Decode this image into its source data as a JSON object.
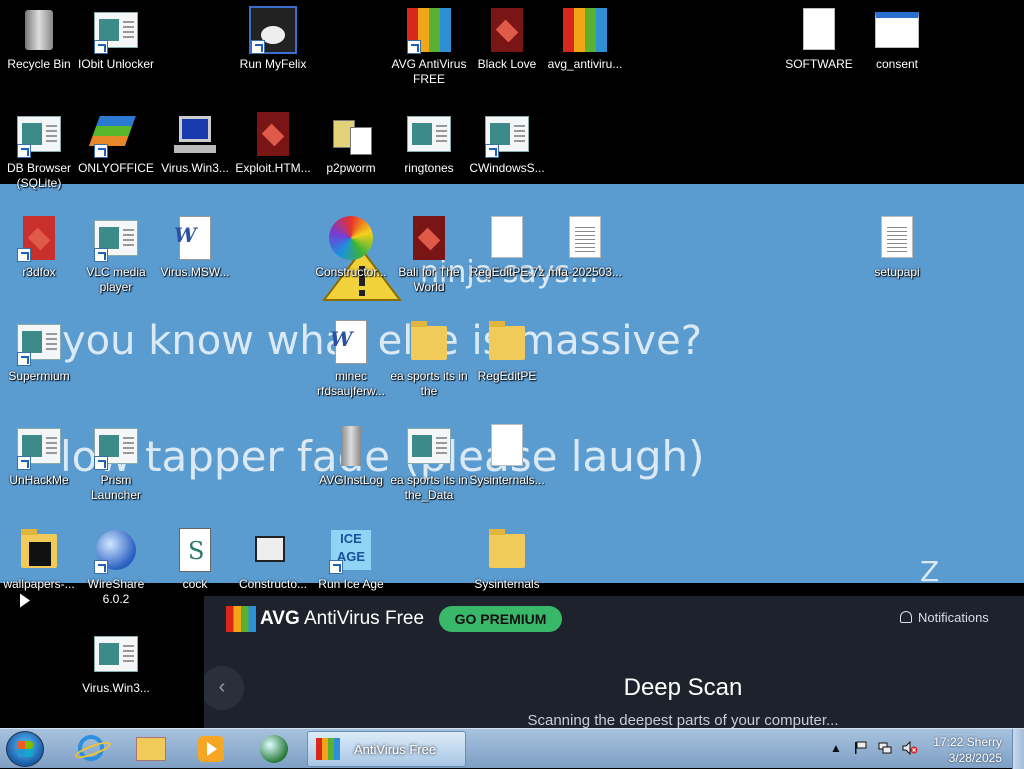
{
  "desktop": {
    "icons": [
      {
        "label": "Recycle Bin",
        "icon": "recycle-bin-icon"
      },
      {
        "label": "IObit Unlocker",
        "icon": "app-icon"
      },
      {
        "label": "Run MyFelix",
        "icon": "cat-icon"
      },
      {
        "label": "AVG AntiVirus FREE",
        "icon": "avg-icon"
      },
      {
        "label": "Black Love",
        "icon": "red-file-icon"
      },
      {
        "label": "avg_antiviru...",
        "icon": "avg-icon"
      },
      {
        "label": "SOFTWARE",
        "icon": "document-icon"
      },
      {
        "label": "consent",
        "icon": "window-icon"
      },
      {
        "label": "DB Browser (SQLite)",
        "icon": "app-icon"
      },
      {
        "label": "ONLYOFFICE",
        "icon": "onlyoffice-icon"
      },
      {
        "label": "Virus.Win3...",
        "icon": "computer-icon"
      },
      {
        "label": "Exploit.HTM...",
        "icon": "red-file-icon"
      },
      {
        "label": "p2pworm",
        "icon": "pills-icon"
      },
      {
        "label": "ringtones",
        "icon": "app-icon"
      },
      {
        "label": "CWindowsS...",
        "icon": "app-icon"
      },
      {
        "label": "r3dfox",
        "icon": "red-file-icon"
      },
      {
        "label": "VLC media player",
        "icon": "app-icon"
      },
      {
        "label": "Virus.MSW...",
        "icon": "word-doc-icon"
      },
      {
        "label": "Constructor...",
        "icon": "swirl-icon"
      },
      {
        "label": "Bali for The World",
        "icon": "red-file-icon"
      },
      {
        "label": "RegEditPE.7z",
        "icon": "document-icon"
      },
      {
        "label": "mfa-202503...",
        "icon": "text-doc-icon"
      },
      {
        "label": "setupapi",
        "icon": "text-doc-icon"
      },
      {
        "label": "Supermium",
        "icon": "app-icon"
      },
      {
        "label": "minec rfdsaujferw...",
        "icon": "word-doc-icon"
      },
      {
        "label": "ea sports its in the",
        "icon": "folder-icon"
      },
      {
        "label": "RegEditPE",
        "icon": "folder-icon"
      },
      {
        "label": "UnHackMe",
        "icon": "app-icon"
      },
      {
        "label": "Prism Launcher",
        "icon": "app-icon"
      },
      {
        "label": "AVGInstLog",
        "icon": "server-icon"
      },
      {
        "label": "ea sports its in the_Data",
        "icon": "app-icon"
      },
      {
        "label": "Sysinternals...",
        "icon": "document-icon"
      },
      {
        "label": "wallpapers-...",
        "icon": "dark-folder-icon"
      },
      {
        "label": "WireShare 6.0.2",
        "icon": "globe-icon"
      },
      {
        "label": "cock",
        "icon": "script-icon"
      },
      {
        "label": "Constructo...",
        "icon": "film-icon"
      },
      {
        "label": "Run Ice Age",
        "icon": "ice-icon"
      },
      {
        "label": "Sysinternals",
        "icon": "folder-icon"
      },
      {
        "label": "Virus.Win3...",
        "icon": "app-icon"
      }
    ],
    "overlay": {
      "ninja": "ninja says...",
      "line1": "you know what else is massive?",
      "line2": "low tapper fade (please laugh)",
      "z": "Z"
    }
  },
  "avg": {
    "brand_bold": "AVG",
    "brand_rest": "AntiVirus Free",
    "go_premium": "GO PREMIUM",
    "notifications": "Notifications",
    "back": "‹",
    "scan_title": "Deep Scan",
    "scan_subtitle": "Scanning the deepest parts of your computer..."
  },
  "taskbar": {
    "active_window": "AntiVirus Free",
    "time": "17:22 Sherry",
    "date": "3/28/2025",
    "tray_up": "▲"
  },
  "colors": {
    "wallpaper_band": "#5a9bd0",
    "avg_bg": "#1e222d",
    "premium_green": "#3ab86a"
  }
}
